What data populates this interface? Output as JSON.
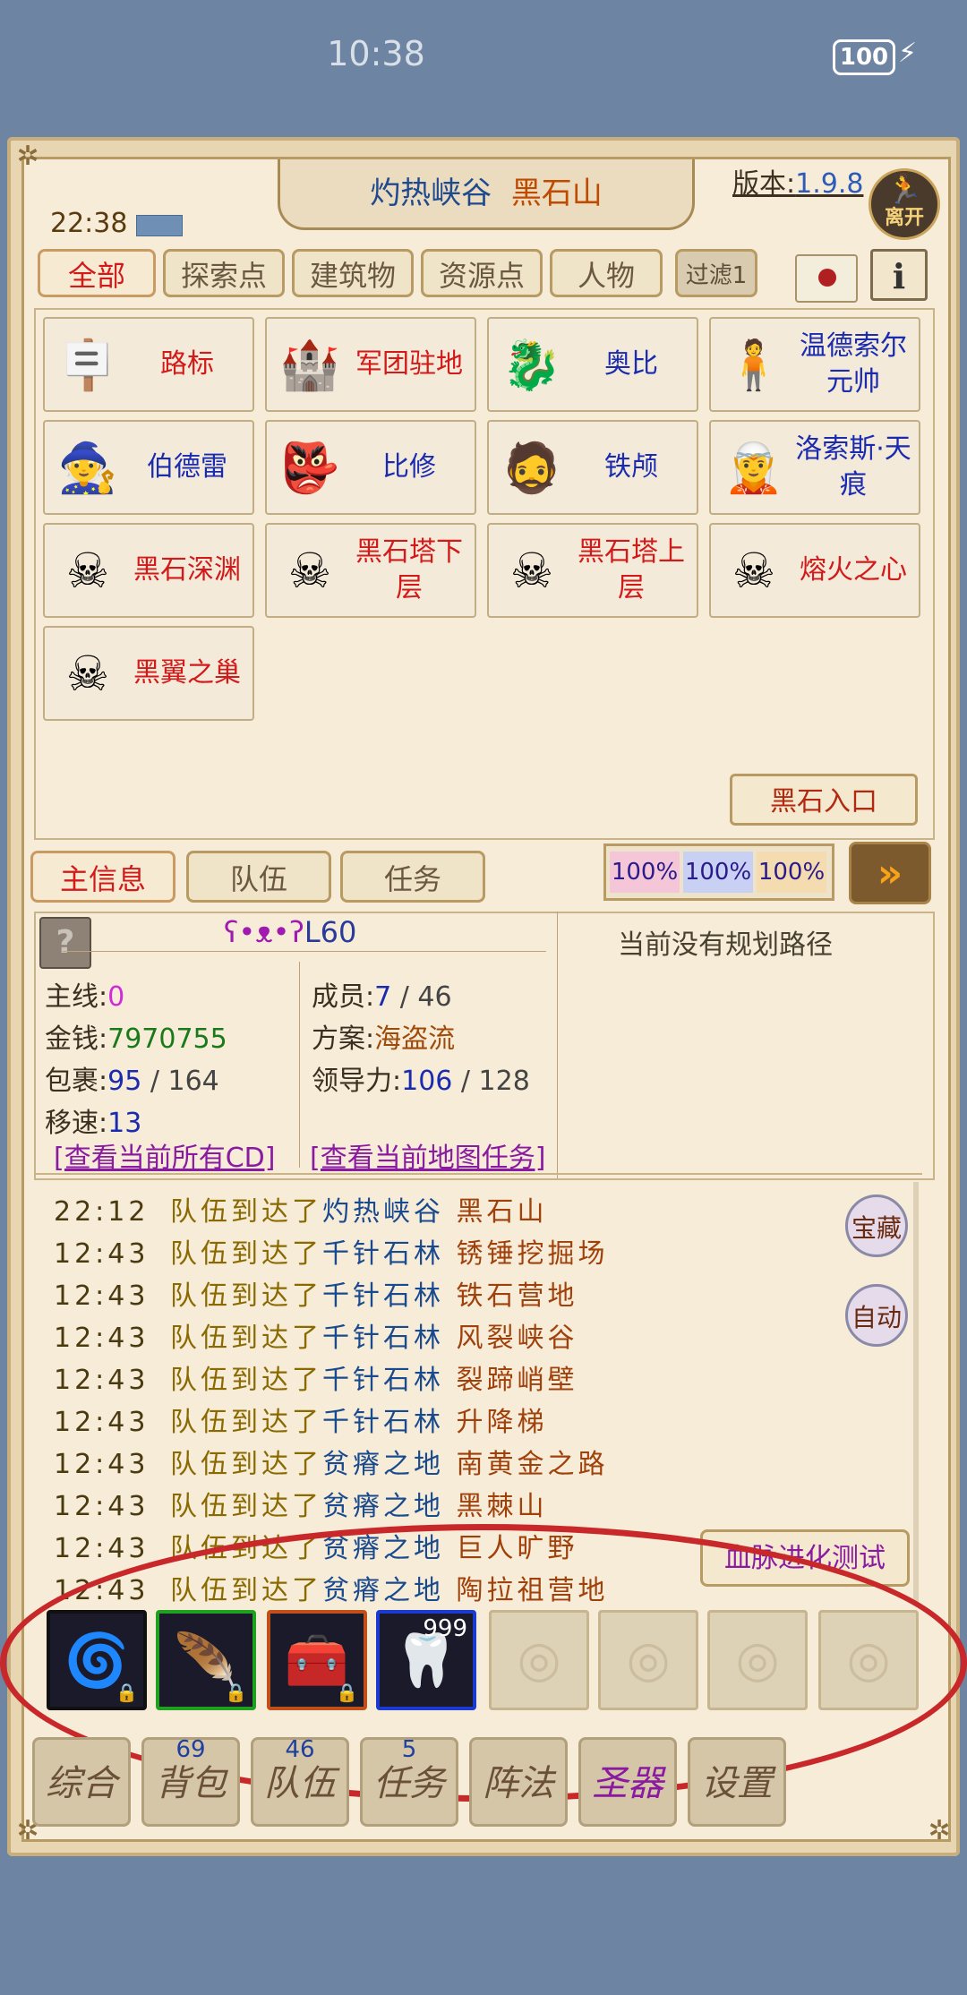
{
  "status_bar": {
    "time": "10:38",
    "battery": "100"
  },
  "header": {
    "zone": "灼热峡谷",
    "area": "黑石山",
    "version_label": "版本:",
    "version_num": "1.9.8",
    "leave_label": "离开",
    "clock": "22:38"
  },
  "filter_tabs": [
    {
      "label": "全部",
      "active": true
    },
    {
      "label": "探索点"
    },
    {
      "label": "建筑物"
    },
    {
      "label": "资源点"
    },
    {
      "label": "人物"
    },
    {
      "label": "过滤1"
    }
  ],
  "poi": [
    {
      "label": "路标",
      "icon": "signpost-icon",
      "glyph": "🪧",
      "color": "red"
    },
    {
      "label": "军团驻地",
      "icon": "castle-icon",
      "glyph": "🏰",
      "color": "red"
    },
    {
      "label": "奥比",
      "icon": "dragon-icon",
      "glyph": "🐉",
      "color": "blue"
    },
    {
      "label": "温德索尔元帅",
      "icon": "npc-icon",
      "glyph": "🧍",
      "color": "blue"
    },
    {
      "label": "伯德雷",
      "icon": "gnome-icon",
      "glyph": "🧙",
      "color": "blue"
    },
    {
      "label": "比修",
      "icon": "goblin-icon",
      "glyph": "👺",
      "color": "blue"
    },
    {
      "label": "铁颅",
      "icon": "dwarf-icon",
      "glyph": "🧔",
      "color": "blue"
    },
    {
      "label": "洛索斯·天痕",
      "icon": "robed-npc-icon",
      "glyph": "🧝",
      "color": "blue"
    },
    {
      "label": "黑石深渊",
      "icon": "skull-swords-icon",
      "glyph": "☠",
      "color": "red"
    },
    {
      "label": "黑石塔下层",
      "icon": "skull-swords-icon",
      "glyph": "☠",
      "color": "red"
    },
    {
      "label": "黑石塔上层",
      "icon": "skull-swords-icon",
      "glyph": "☠",
      "color": "red"
    },
    {
      "label": "熔火之心",
      "icon": "skull-swords-icon",
      "glyph": "☠",
      "color": "red"
    },
    {
      "label": "黑翼之巢",
      "icon": "skull-swords-icon",
      "glyph": "☠",
      "color": "red"
    }
  ],
  "entrance_button": "黑石入口",
  "info_tabs": [
    {
      "label": "主信息",
      "active": true
    },
    {
      "label": "队伍"
    },
    {
      "label": "任务"
    }
  ],
  "percentages": [
    "100%",
    "100%",
    "100%"
  ],
  "team": {
    "symbol": "ʕ•ᴥ•ʔ",
    "level": "L60",
    "mainline_label": "主线:",
    "mainline": "0",
    "money_label": "金钱:",
    "money": "7970755",
    "bag_label": "包裹:",
    "bag_used": "95",
    "bag_total": " / 164",
    "speed_label": "移速:",
    "speed": "13",
    "members_label": "成员:",
    "members": "7",
    "members_total": " / 46",
    "plan_label": "方案:",
    "plan": "海盗流",
    "leader_label": "领导力:",
    "leader": "106",
    "leader_total": " / 128",
    "link_cd": "[查看当前所有CD]",
    "link_quest": "[查看当前地图任务]",
    "route": "当前没有规划路径"
  },
  "log": [
    {
      "time": "22:12",
      "msg": "队伍到达了",
      "p1": "灼热峡谷",
      "p2": "黑石山"
    },
    {
      "time": "12:43",
      "msg": "队伍到达了",
      "p1": "千针石林",
      "p2": "锈锤挖掘场"
    },
    {
      "time": "12:43",
      "msg": "队伍到达了",
      "p1": "千针石林",
      "p2": "铁石营地"
    },
    {
      "time": "12:43",
      "msg": "队伍到达了",
      "p1": "千针石林",
      "p2": "风裂峡谷"
    },
    {
      "time": "12:43",
      "msg": "队伍到达了",
      "p1": "千针石林",
      "p2": "裂蹄峭壁"
    },
    {
      "time": "12:43",
      "msg": "队伍到达了",
      "p1": "千针石林",
      "p2": "升降梯"
    },
    {
      "time": "12:43",
      "msg": "队伍到达了",
      "p1": "贫瘠之地",
      "p2": "南黄金之路"
    },
    {
      "time": "12:43",
      "msg": "队伍到达了",
      "p1": "贫瘠之地",
      "p2": "黑棘山"
    },
    {
      "time": "12:43",
      "msg": "队伍到达了",
      "p1": "贫瘠之地",
      "p2": "巨人旷野"
    },
    {
      "time": "12:43",
      "msg": "队伍到达了",
      "p1": "贫瘠之地",
      "p2": "陶拉祖营地"
    }
  ],
  "side_buttons": {
    "treasure": "宝藏",
    "auto": "自动"
  },
  "bloodline_button": "血脉进化测试",
  "slots": [
    {
      "icon": "rune-stone-icon",
      "glyph": "🌀",
      "border": "#111111",
      "locked": true
    },
    {
      "icon": "feather-staff-icon",
      "glyph": "🪶",
      "border": "#1fa01f",
      "locked": true
    },
    {
      "icon": "chest-icon",
      "glyph": "🧰",
      "border": "#c0501a",
      "locked": true
    },
    {
      "icon": "fang-necklace-icon",
      "glyph": "🦷",
      "border": "#1a3ad0",
      "qty": "999"
    }
  ],
  "bottom_nav": [
    {
      "label": "综合",
      "badge": ""
    },
    {
      "label": "背包",
      "badge": "69"
    },
    {
      "label": "队伍",
      "badge": "46"
    },
    {
      "label": "任务",
      "badge": "5"
    },
    {
      "label": "阵法",
      "badge": ""
    },
    {
      "label": "圣器",
      "badge": "",
      "color": "#8a1aa0"
    },
    {
      "label": "设置",
      "badge": ""
    }
  ]
}
